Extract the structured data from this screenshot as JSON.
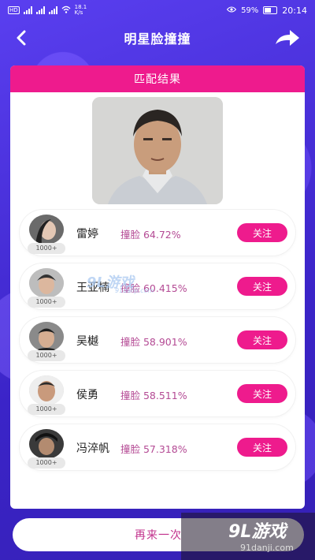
{
  "statusbar": {
    "network_speed": "18.1\nK/s",
    "battery": "59%",
    "time": "20:14"
  },
  "nav": {
    "title": "明星脸撞撞"
  },
  "card": {
    "header": "匹配结果"
  },
  "matches": [
    {
      "name": "雷婷",
      "score": "撞脸 64.72%",
      "fans": "1000+",
      "follow": "关注"
    },
    {
      "name": "王亚楠",
      "score": "撞脸 60.415%",
      "fans": "1000+",
      "follow": "关注"
    },
    {
      "name": "吴樾",
      "score": "撞脸 58.901%",
      "fans": "1000+",
      "follow": "关注"
    },
    {
      "name": "侯勇",
      "score": "撞脸 58.511%",
      "fans": "1000+",
      "follow": "关注"
    },
    {
      "name": "冯淬帆",
      "score": "撞脸 57.318%",
      "fans": "1000+",
      "follow": "关注"
    }
  ],
  "retry_label": "再来一次",
  "watermark": {
    "logo": "9L游戏",
    "url": "91danji.com"
  },
  "colors": {
    "accent": "#ee1b8d",
    "background": "#4a2fd9",
    "score_text": "#b44a94"
  }
}
